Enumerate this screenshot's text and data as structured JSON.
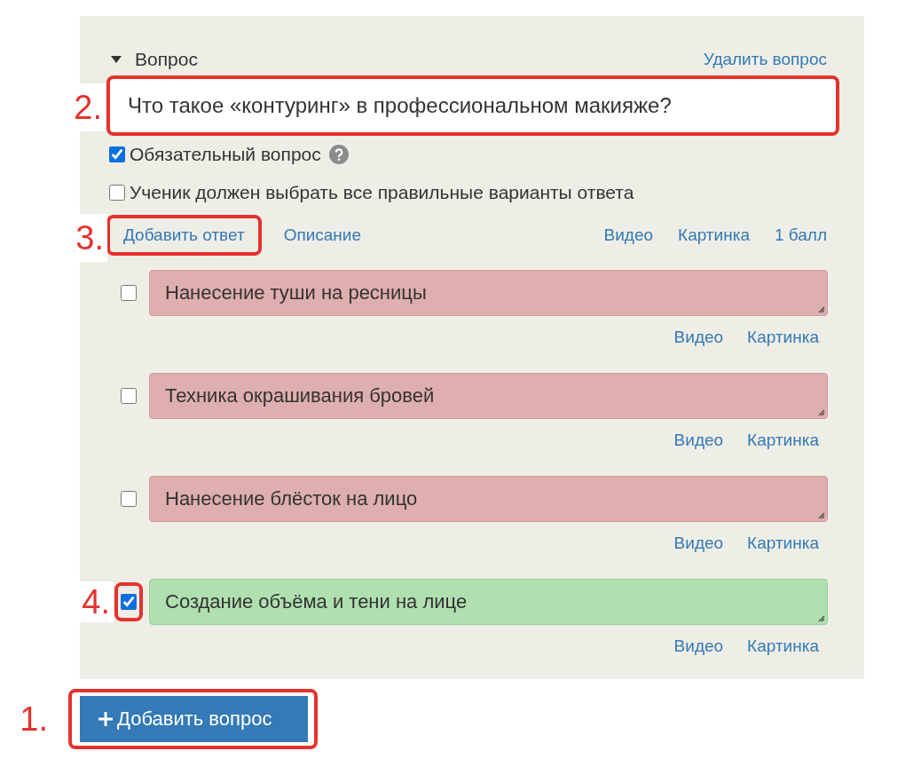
{
  "question_header": {
    "title": "Вопрос",
    "expanded": true,
    "delete_link": "Удалить вопрос"
  },
  "question_field": {
    "value": "Что такое «контуринг» в профессиональном макияже?",
    "annotation": "2."
  },
  "options": [
    {
      "label": "Обязательный вопрос",
      "checked": true,
      "help": true
    },
    {
      "label": "Ученик должен выбрать все правильные варианты ответа",
      "checked": false,
      "help": false
    }
  ],
  "toolbar": {
    "add_answer": "Добавить ответ",
    "add_answer_annotation": "3.",
    "description": "Описание",
    "video": "Видео",
    "picture": "Картинка",
    "points": "1 балл"
  },
  "answers": [
    {
      "text": "Нанесение туши на ресницы",
      "correct": false,
      "video": "Видео",
      "picture": "Картинка"
    },
    {
      "text": "Техника окрашивания бровей",
      "correct": false,
      "video": "Видео",
      "picture": "Картинка"
    },
    {
      "text": "Нанесение блёсток на лицо",
      "correct": false,
      "video": "Видео",
      "picture": "Картинка"
    },
    {
      "text": "Создание объёма и тени на лице",
      "correct": true,
      "video": "Видео",
      "picture": "Картинка",
      "annotation": "4."
    }
  ],
  "add_question_button": {
    "label": "Добавить вопрос",
    "annotation": "1."
  }
}
